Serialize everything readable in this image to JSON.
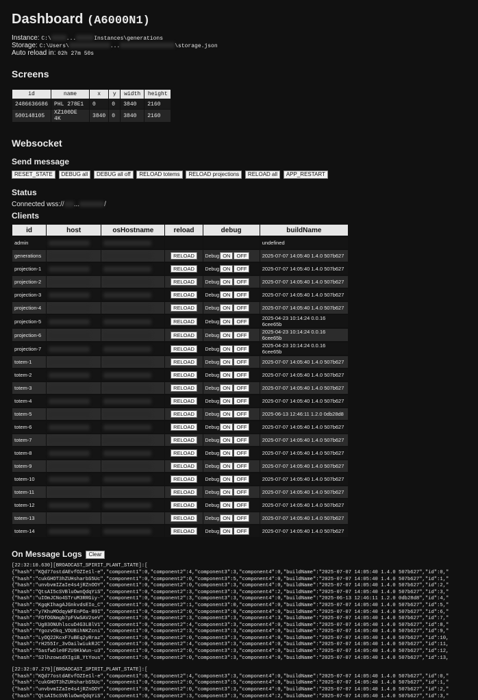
{
  "header": {
    "title": "Dashboard",
    "code": "(A6000N1)",
    "instance_label": "Instance:",
    "instance_prefix": "C:\\",
    "instance_mid": "...",
    "instance_suffix": "Instances\\generations",
    "storage_label": "Storage:",
    "storage_prefix": "C:\\Users\\",
    "storage_mid": "...",
    "storage_suffix": "\\storage.json",
    "reload_label": "Auto reload in:",
    "reload_value": "02h 27m 50s"
  },
  "screens": {
    "title": "Screens",
    "columns": [
      "id",
      "name",
      "x",
      "y",
      "width",
      "height"
    ],
    "rows": [
      [
        "2486636686",
        "PHL 278E1",
        "0",
        "0",
        "3840",
        "2160"
      ],
      [
        "500148105",
        "XZ100DE 4K",
        "3840",
        "0",
        "3840",
        "2160"
      ]
    ]
  },
  "websocket": {
    "title": "Websocket",
    "send_title": "Send message",
    "buttons": [
      "RESET_STATE",
      "DEBUG all",
      "DEBUG all off",
      "RELOAD totems",
      "RELOAD projections",
      "RELOAD all",
      "APP_RESTART"
    ],
    "status_title": "Status",
    "status_prefix": "Connected wss://",
    "status_mid": "...",
    "status_suffix": "/"
  },
  "clients": {
    "title": "Clients",
    "columns": [
      "id",
      "host",
      "osHostname",
      "reload",
      "debug",
      "buildName"
    ],
    "reload_label": "RELOAD",
    "debug_label": "Debug",
    "on_label": "ON",
    "off_label": "OFF",
    "rows": [
      {
        "id": "admin",
        "build": "undefined",
        "controls": false
      },
      {
        "id": "generations",
        "build": "2025-07-07 14:05:40 1.4.0 507b627",
        "controls": true
      },
      {
        "id": "projection-1",
        "build": "2025-07-07 14:05:40 1.4.0 507b627",
        "controls": true
      },
      {
        "id": "projection-2",
        "build": "2025-07-07 14:05:40 1.4.0 507b627",
        "controls": true
      },
      {
        "id": "projection-3",
        "build": "2025-07-07 14:05:40 1.4.0 507b627",
        "controls": true
      },
      {
        "id": "projection-4",
        "build": "2025-07-07 14:05:40 1.4.0 507b627",
        "controls": true
      },
      {
        "id": "projection-5",
        "build": "2025-04-23 10:14:24 0.0.16 6cee65b",
        "controls": true
      },
      {
        "id": "projection-6",
        "build": "2025-04-23 10:14:24 0.0.16 6cee65b",
        "controls": true
      },
      {
        "id": "projection-7",
        "build": "2025-04-23 10:14:24 0.0.16 6cee65b",
        "controls": true
      },
      {
        "id": "totem-1",
        "build": "2025-07-07 14:05:40 1.4.0 507b627",
        "controls": true
      },
      {
        "id": "totem-2",
        "build": "2025-07-07 14:05:40 1.4.0 507b627",
        "controls": true
      },
      {
        "id": "totem-3",
        "build": "2025-07-07 14:05:40 1.4.0 507b627",
        "controls": true
      },
      {
        "id": "totem-4",
        "build": "2025-07-07 14:05:40 1.4.0 507b627",
        "controls": true
      },
      {
        "id": "totem-5",
        "build": "2025-06-13 12:46:11 1.2.0 0db28d8",
        "controls": true
      },
      {
        "id": "totem-6",
        "build": "2025-07-07 14:05:40 1.4.0 507b627",
        "controls": true
      },
      {
        "id": "totem-7",
        "build": "2025-07-07 14:05:40 1.4.0 507b627",
        "controls": true
      },
      {
        "id": "totem-8",
        "build": "2025-07-07 14:05:40 1.4.0 507b627",
        "controls": true
      },
      {
        "id": "totem-9",
        "build": "2025-07-07 14:05:40 1.4.0 507b627",
        "controls": true
      },
      {
        "id": "totem-10",
        "build": "2025-07-07 14:05:40 1.4.0 507b627",
        "controls": true
      },
      {
        "id": "totem-11",
        "build": "2025-07-07 14:05:40 1.4.0 507b627",
        "controls": true
      },
      {
        "id": "totem-12",
        "build": "2025-07-07 14:05:40 1.4.0 507b627",
        "controls": true
      },
      {
        "id": "totem-13",
        "build": "2025-07-07 14:05:40 1.4.0 507b627",
        "controls": true
      },
      {
        "id": "totem-14",
        "build": "2025-07-07 14:05:40 1.4.0 507b627",
        "controls": true
      }
    ]
  },
  "logs": {
    "title": "On Message Logs",
    "clear_label": "Clear",
    "blocks": [
      {
        "header": "[22:32:10.630][BROADCAST_SPIRIT_PLANT_STATE]:[",
        "lines": [
          "{\"hash\":\"KQd77ostdAEvfOZIe1l-e\",\"component1\":0,\"component2\":4,\"component3\":3,\"component4\":0,\"buildName\":\"2025-07-07 14:05:40 1.4.0 507b627\",\"id\":0,\"",
          "{\"hash\":\"cukGHOT3hZUHsharbS5Uc\",\"component1\":0,\"component2\":0,\"component3\":5,\"component4\":0,\"buildName\":\"2025-07-07 14:05:40 1.4.0 507b627\",\"id\":1,\"",
          "{\"hash\":\"unvbvmIZaIe4s4jRZnOOY\",\"component1\":0,\"component2\":0,\"component3\":3,\"component4\":0,\"buildName\":\"2025-07-07 14:05:40 1.4.0 507b627\",\"id\":2,\"",
          "{\"hash\":\"QtsAI5cSVBluOwnQdqYiS\",\"component1\":0,\"component2\":3,\"component3\":3,\"component4\":2,\"buildName\":\"2025-07-07 14:05:40 1.4.0 507b627\",\"id\":3,\"",
          "{\"hash\":\"uIOmJCNo4STruM3RRGiy-\",\"component1\":0,\"component2\":3,\"component3\":3,\"component4\":0,\"buildName\":\"2025-06-13 12:46:11 1.2.0 0db28d8\",\"id\":4,\"",
          "{\"hash\":\"KgqKIhagAJGnkvdsEIo_C\",\"component1\":0,\"component2\":1,\"component3\":0,\"component4\":0,\"buildName\":\"2025-07-07 14:05:40 1.4.0 507b627\",\"id\":5,\"",
          "{\"hash\":\"y7KhuMOdqyWFEnPOa-89I\",\"component1\":0,\"component2\":0,\"component3\":0,\"component4\":0,\"buildName\":\"2025-07-07 14:05:40 1.4.0 507b627\",\"id\":6,\"",
          "{\"hash\":\"FDfOGNmgb7pFVwSAV2seV\",\"component1\":0,\"component2\":3,\"component3\":3,\"component4\":3,\"buildName\":\"2025-07-07 14:05:40 1.4.0 507b627\",\"id\":7,\"",
          "{\"hash\":\"Ug83ONUhlscuD4G3LBlV1\",\"component1\":0,\"component2\":4,\"component3\":3,\"component4\":0,\"buildName\":\"2025-07-07 14:05:40 1.4.0 507b627\",\"id\":8,\"",
          "{\"hash\":\"YgozvOkq_VDUBihNKZcni\",\"component1\":0,\"component2\":3,\"component3\":3,\"component4\":0,\"buildName\":\"2025-07-07 14:05:40 1.4.0 507b627\",\"id\":9,\"",
          "{\"hash\":\"LyOQ22KcxF7uBEq2yRraz\",\"component1\":0,\"component2\":0,\"component3\":3,\"component4\":0,\"buildName\":\"2025-07-07 14:05:40 1.4.0 507b627\",\"id\":10,",
          "{\"hash\":\"rH255Ir_3vOailwiukRJC\",\"component1\":0,\"component2\":4,\"component3\":3,\"component4\":0,\"buildName\":\"2025-07-07 14:05:40 1.4.0 507b627\",\"id\":11,",
          "{\"hash\":\"5asfwDle0FZU9KkWun-u3\",\"component1\":0,\"component2\":0,\"component3\":3,\"component4\":0,\"buildName\":\"2025-07-07 14:05:40 1.4.0 507b627\",\"id\":12,",
          "{\"hash\":\"S2lhzowsdXIgiB_YtYous\",\"component1\":0,\"component2\":0,\"component3\":3,\"component4\":0,\"buildName\":\"2025-07-07 14:05:40 1.4.0 507b627\",\"id\":13,"
        ]
      },
      {
        "header": "[22:32:07.279][BROADCAST_SPIRIT_PLANT_STATE]:[",
        "lines": [
          "{\"hash\":\"KQd77ostdAEvfOZIe1l-e\",\"component1\":0,\"component2\":4,\"component3\":3,\"component4\":0,\"buildName\":\"2025-07-07 14:05:40 1.4.0 507b627\",\"id\":0,\"",
          "{\"hash\":\"cukGHOT3hZUHsharbS5Uc\",\"component1\":0,\"component2\":0,\"component3\":5,\"component4\":0,\"buildName\":\"2025-07-07 14:05:40 1.4.0 507b627\",\"id\":1,\"",
          "{\"hash\":\"unvbvmIZaIe4s4jRZnOOY\",\"component1\":0,\"component2\":0,\"component3\":3,\"component4\":0,\"buildName\":\"2025-07-07 14:05:40 1.4.0 507b627\",\"id\":2,\"",
          "{\"hash\":\"QtsAI5cSVBluOwnQdqYiS\",\"component1\":0,\"component2\":3,\"component3\":3,\"component4\":2,\"buildName\":\"2025-07-07 14:05:40 1.4.0 507b627\",\"id\":3,\""
        ]
      }
    ]
  }
}
